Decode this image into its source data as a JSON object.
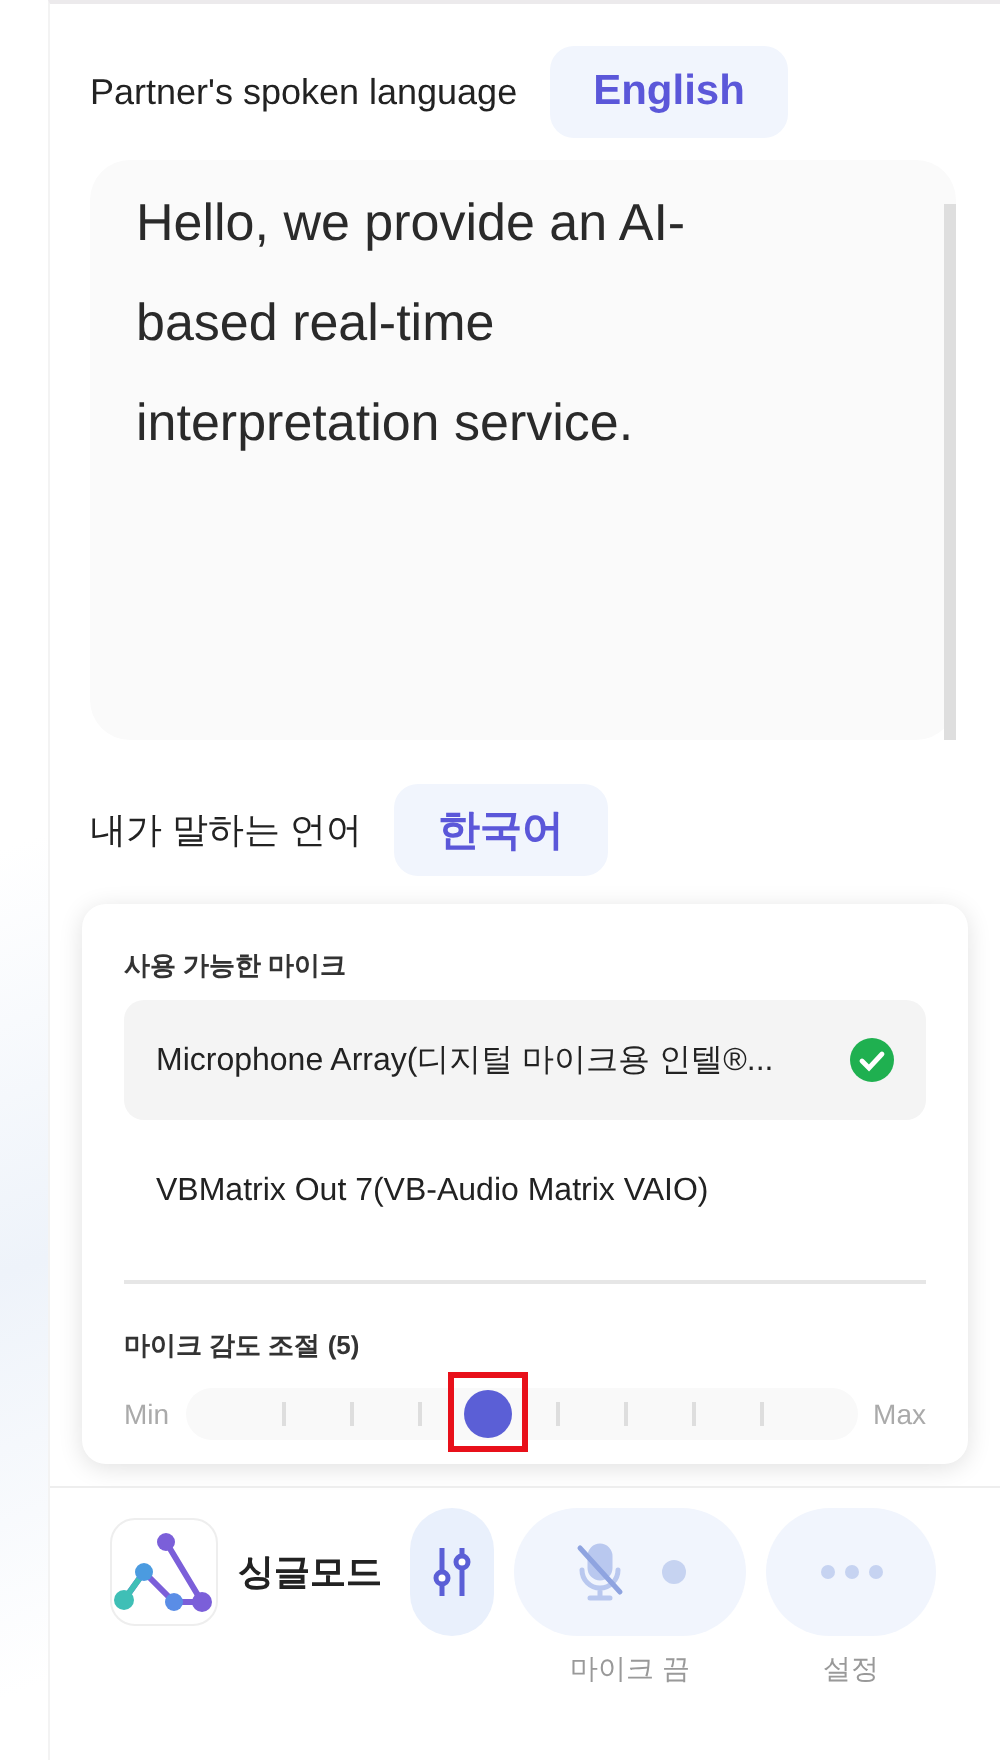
{
  "partner_language": {
    "label": "Partner's spoken language",
    "value": "English"
  },
  "transcript": {
    "text": "Hello, we provide an AI-based real-time interpretation service."
  },
  "my_language": {
    "label": "내가 말하는 언어",
    "value": "한국어"
  },
  "mic_panel": {
    "title": "사용 가능한 마이크",
    "microphones": [
      {
        "name": "Microphone Array(디지털 마이크용 인텔®...",
        "selected": true
      },
      {
        "name": "VBMatrix Out 7(VB-Audio Matrix VAIO)",
        "selected": false
      }
    ],
    "sensitivity": {
      "label": "마이크 감도 조절 (5)",
      "min_label": "Min",
      "max_label": "Max",
      "level": 0.45,
      "highlighted": true
    }
  },
  "bottom_bar": {
    "mode": "싱글모드",
    "mixer_selected": true,
    "buttons": [
      {
        "kind": "mic",
        "label": "마이크 끔",
        "on": false
      },
      {
        "kind": "more",
        "label": "설정"
      }
    ]
  }
}
